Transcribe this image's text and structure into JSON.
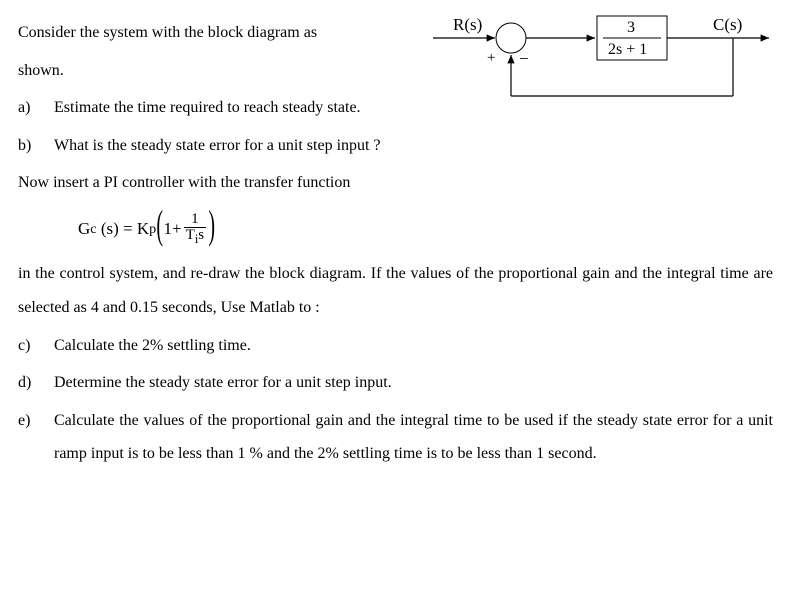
{
  "intro": {
    "line1": "Consider the system with the block diagram as",
    "line2": "shown."
  },
  "parts": {
    "a": {
      "letter": "a)",
      "text": "Estimate the time required to reach steady state."
    },
    "b": {
      "letter": "b)",
      "text": "What is the steady state error for a unit step input ?"
    },
    "c": {
      "letter": "c)",
      "text": "Calculate the 2% settling time."
    },
    "d": {
      "letter": "d)",
      "text": "Determine the steady state error for a unit step input."
    },
    "e": {
      "letter": "e)",
      "text": "Calculate the values of the proportional gain and the integral time to be used if the steady state error for a unit ramp input is to be less than 1 % and the 2% settling time is to be less than 1 second."
    }
  },
  "mid1": "Now insert a PI controller with the transfer function",
  "formula": {
    "lhs_g": "G",
    "lhs_sub": "c",
    "lhs_arg": "(s) = K",
    "lhs_psub": "p",
    "one_plus": "1+",
    "frac_num": "1",
    "frac_den_t": "T",
    "frac_den_sub": "i",
    "frac_den_s": "s"
  },
  "mid2": "in the control system, and re-draw the block diagram. If the values of the proportional gain and the integral time are selected as 4 and 0.15 seconds, Use Matlab to :",
  "diagram": {
    "r_label": "R(s)",
    "c_label": "C(s)",
    "plus": "+",
    "minus": "−",
    "tf_num": "3",
    "tf_den": "2s + 1"
  }
}
